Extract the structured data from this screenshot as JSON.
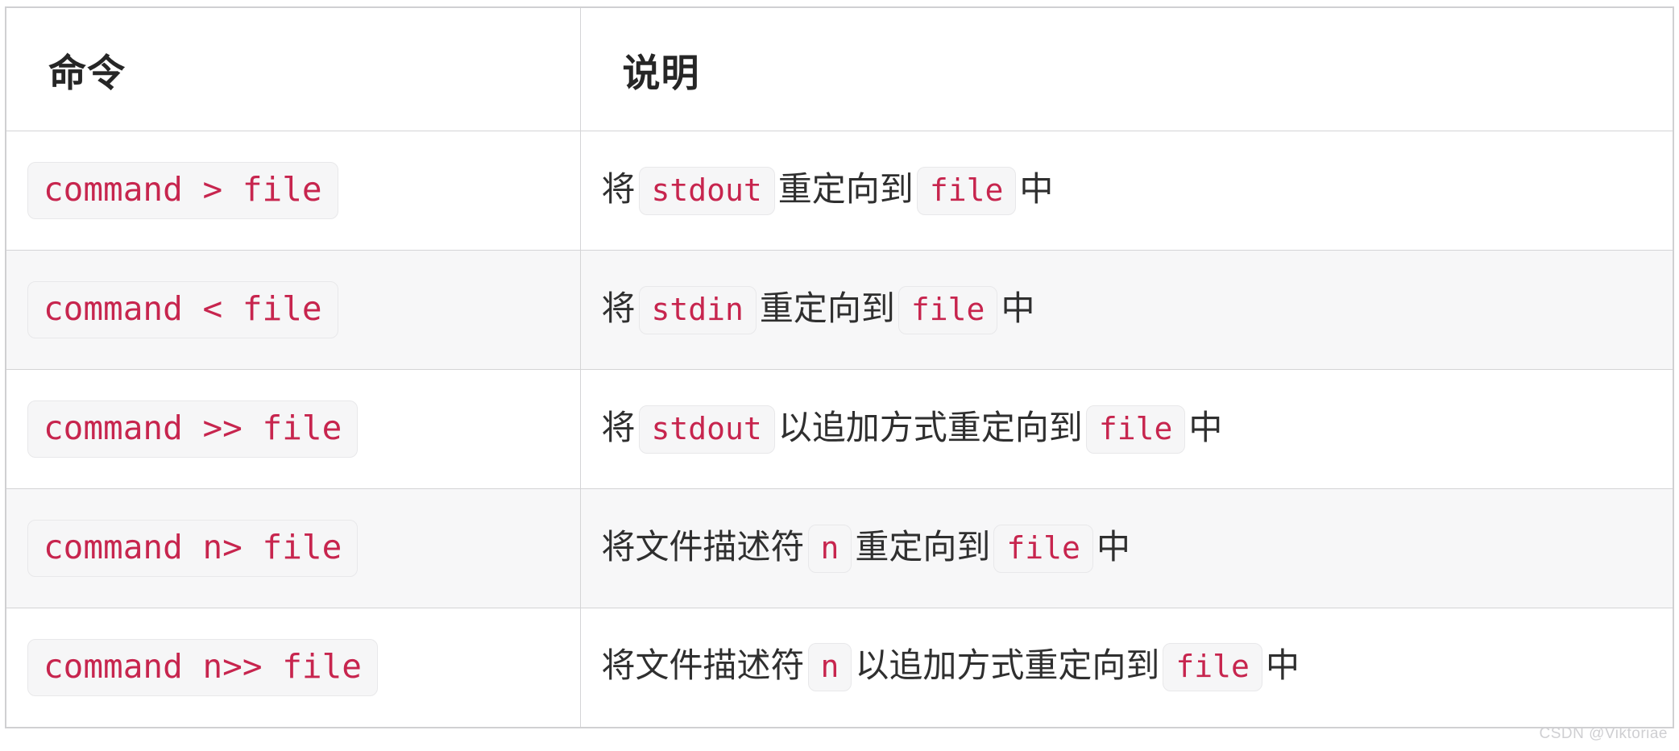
{
  "table": {
    "headers": {
      "command": "命令",
      "description": "说明"
    },
    "rows": [
      {
        "command": "command > file",
        "description_parts": [
          {
            "type": "text",
            "value": "将"
          },
          {
            "type": "code",
            "value": "stdout"
          },
          {
            "type": "text",
            "value": "重定向到"
          },
          {
            "type": "code",
            "value": "file"
          },
          {
            "type": "text",
            "value": "中"
          }
        ],
        "striped": false
      },
      {
        "command": "command < file",
        "description_parts": [
          {
            "type": "text",
            "value": "将"
          },
          {
            "type": "code",
            "value": "stdin"
          },
          {
            "type": "text",
            "value": "重定向到"
          },
          {
            "type": "code",
            "value": "file"
          },
          {
            "type": "text",
            "value": "中"
          }
        ],
        "striped": true
      },
      {
        "command": "command >> file",
        "description_parts": [
          {
            "type": "text",
            "value": "将"
          },
          {
            "type": "code",
            "value": "stdout"
          },
          {
            "type": "text",
            "value": "以追加方式重定向到"
          },
          {
            "type": "code",
            "value": "file"
          },
          {
            "type": "text",
            "value": "中"
          }
        ],
        "striped": false
      },
      {
        "command": "command n> file",
        "description_parts": [
          {
            "type": "text",
            "value": "将文件描述符"
          },
          {
            "type": "code",
            "value": "n"
          },
          {
            "type": "text",
            "value": "重定向到"
          },
          {
            "type": "code",
            "value": "file"
          },
          {
            "type": "text",
            "value": "中"
          }
        ],
        "striped": true
      },
      {
        "command": "command n>> file",
        "description_parts": [
          {
            "type": "text",
            "value": "将文件描述符"
          },
          {
            "type": "code",
            "value": "n"
          },
          {
            "type": "text",
            "value": "以追加方式重定向到"
          },
          {
            "type": "code",
            "value": "file"
          },
          {
            "type": "text",
            "value": "中"
          }
        ],
        "striped": false
      }
    ]
  },
  "watermark": "CSDN @Viktoriae",
  "colors": {
    "code_text": "#c7254e",
    "code_background": "#f6f6f7",
    "code_border": "#e8e8ea",
    "table_border": "#d4d4d6",
    "row_striped_background": "#f7f7f8",
    "text": "#2b2b2b",
    "watermark": "#cfcfd2"
  }
}
